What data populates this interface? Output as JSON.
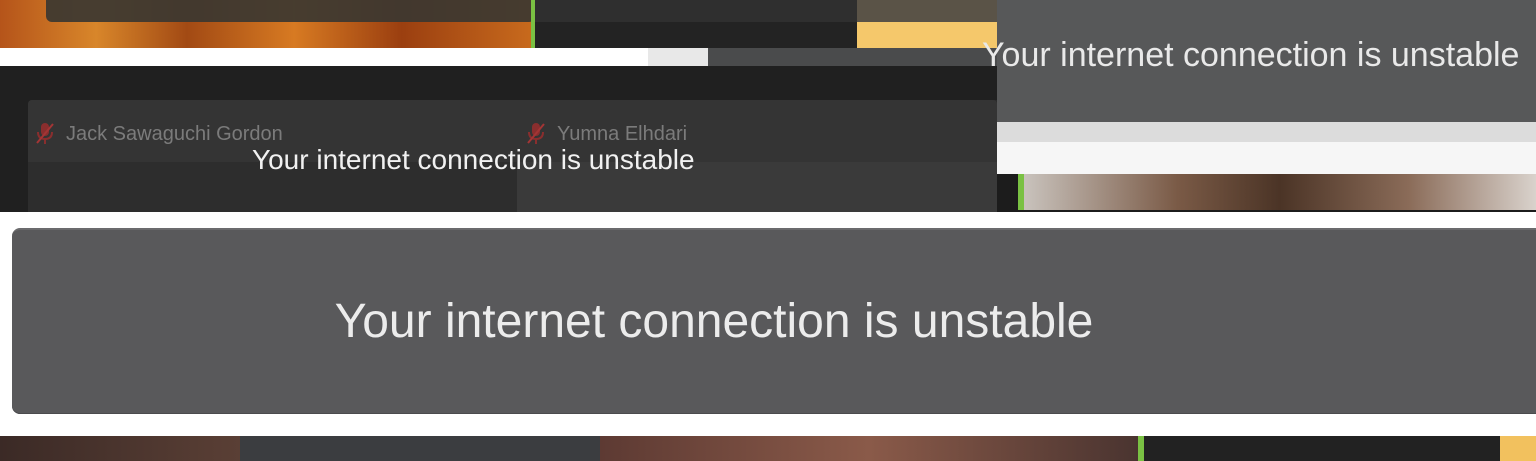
{
  "top_toast": {
    "message": "Your internet connection is unstable"
  },
  "participants": [
    {
      "name": "Jack Sawaguchi Gordon",
      "mic_icon": "mic-off-icon"
    },
    {
      "name": "Yumna Elhdari",
      "mic_icon": "mic-off-icon"
    }
  ],
  "mid_toast": {
    "message": "Your internet connection is unstable"
  },
  "main_toast": {
    "message": "Your internet connection is unstable"
  },
  "colors": {
    "toast_background": "#59595b",
    "active_speaker": "#7ac143",
    "toast_text": "#ececec"
  }
}
